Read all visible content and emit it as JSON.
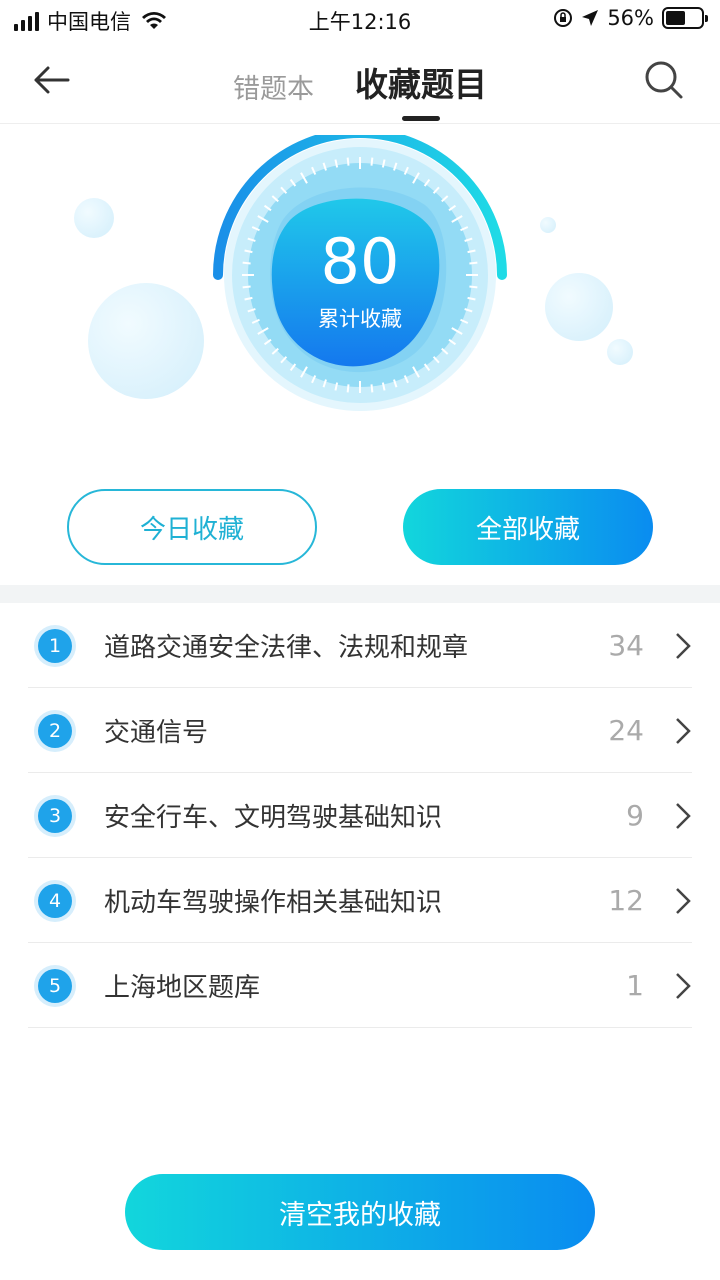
{
  "status_bar": {
    "carrier": "中国电信",
    "time": "上午12:16",
    "battery_percent": "56%",
    "battery_level": 0.56,
    "icons": [
      "signal-icon",
      "wifi-icon",
      "rotation-lock-icon",
      "location-icon",
      "battery-icon"
    ]
  },
  "nav": {
    "tab_wrong": "错题本",
    "tab_favorites": "收藏题目",
    "back_icon": "back-arrow-icon",
    "search_icon": "search-icon"
  },
  "summary": {
    "count": "80",
    "label": "累计收藏"
  },
  "filters": {
    "today": "今日收藏",
    "all": "全部收藏"
  },
  "categories": [
    {
      "num": "1",
      "title": "道路交通安全法律、法规和规章",
      "count": "34"
    },
    {
      "num": "2",
      "title": "交通信号",
      "count": "24"
    },
    {
      "num": "3",
      "title": "安全行车、文明驾驶基础知识",
      "count": "9"
    },
    {
      "num": "4",
      "title": "机动车驾驶操作相关基础知识",
      "count": "12"
    },
    {
      "num": "5",
      "title": "上海地区题库",
      "count": "1"
    }
  ],
  "actions": {
    "clear": "清空我的收藏"
  },
  "colors": {
    "accent_start": "#12d6dc",
    "accent_end": "#0a8cf0",
    "badge": "#1fa3ea"
  }
}
